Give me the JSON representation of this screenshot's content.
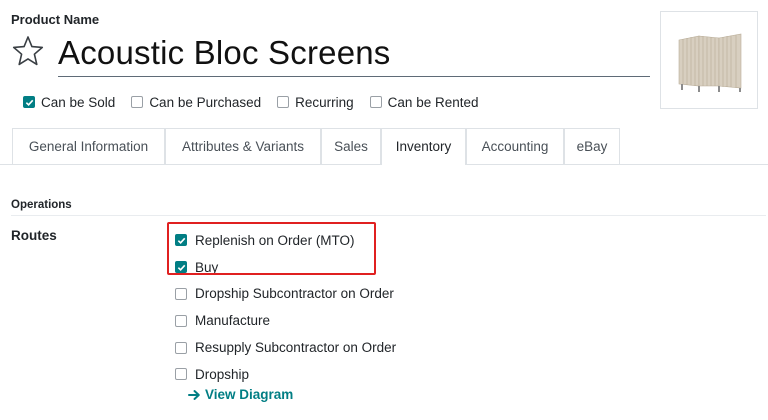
{
  "product": {
    "name_label": "Product Name",
    "name": "Acoustic Bloc Screens"
  },
  "flags": [
    {
      "label": "Can be Sold",
      "checked": true
    },
    {
      "label": "Can be Purchased",
      "checked": false
    },
    {
      "label": "Recurring",
      "checked": false
    },
    {
      "label": "Can be Rented",
      "checked": false
    }
  ],
  "tabs": [
    {
      "label": "General Information",
      "active": false
    },
    {
      "label": "Attributes & Variants",
      "active": false
    },
    {
      "label": "Sales",
      "active": false
    },
    {
      "label": "Inventory",
      "active": true
    },
    {
      "label": "Accounting",
      "active": false
    },
    {
      "label": "eBay",
      "active": false
    }
  ],
  "operations": {
    "section_title": "Operations",
    "routes_label": "Routes",
    "routes": [
      {
        "label": "Replenish on Order (MTO)",
        "checked": true
      },
      {
        "label": "Buy",
        "checked": true
      },
      {
        "label": "Dropship Subcontractor on Order",
        "checked": false
      },
      {
        "label": "Manufacture",
        "checked": false
      },
      {
        "label": "Resupply Subcontractor on Order",
        "checked": false
      },
      {
        "label": "Dropship",
        "checked": false
      }
    ],
    "view_diagram_label": "View Diagram"
  },
  "colors": {
    "accent": "#017e84",
    "highlight": "#e02020"
  }
}
